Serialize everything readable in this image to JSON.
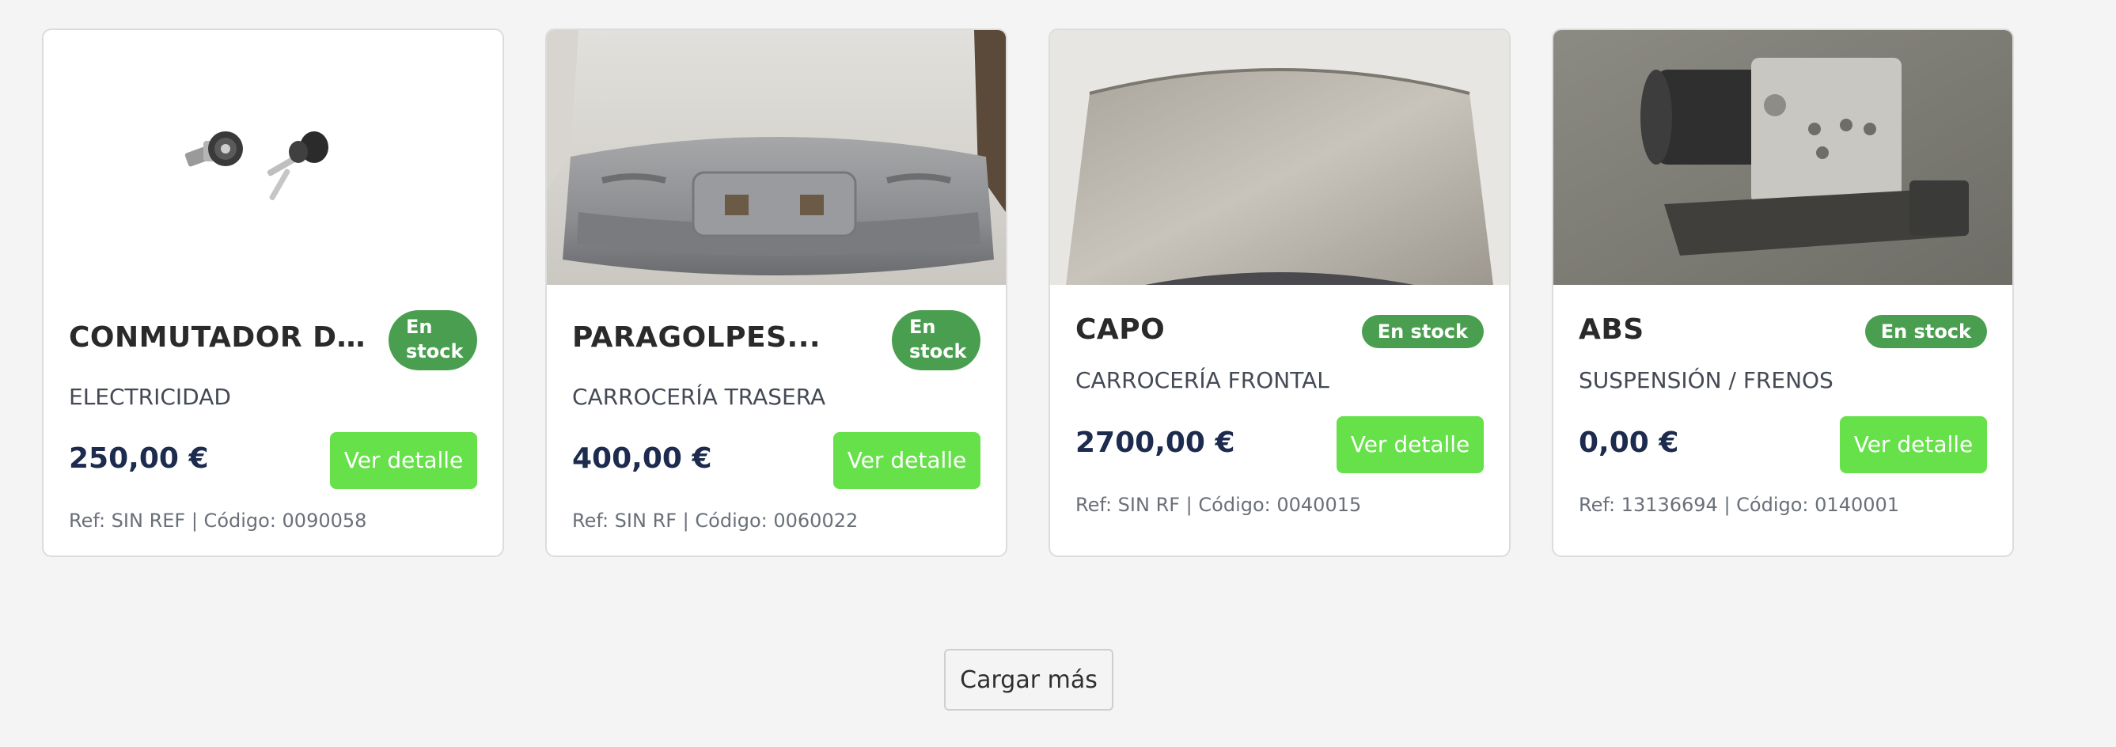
{
  "products": [
    {
      "title": "CONMUTADOR DE...",
      "badge": "En stock",
      "category": "ELECTRICIDAD",
      "price": "250,00 €",
      "button": "Ver detalle",
      "ref": "Ref: SIN REF | Código: 0090058",
      "image": "ignition-switch-with-keys"
    },
    {
      "title": "PARAGOLPES...",
      "badge": "En stock",
      "category": "CARROCERÍA TRASERA",
      "price": "400,00 €",
      "button": "Ver detalle",
      "ref": "Ref: SIN RF | Código: 0060022",
      "image": "rear-bumper"
    },
    {
      "title": "CAPO",
      "badge": "En stock",
      "category": "CARROCERÍA FRONTAL",
      "price": "2700,00 €",
      "button": "Ver detalle",
      "ref": "Ref: SIN RF | Código: 0040015",
      "image": "car-hood"
    },
    {
      "title": "ABS",
      "badge": "En stock",
      "category": "SUSPENSIÓN / FRENOS",
      "price": "0,00 €",
      "button": "Ver detalle",
      "ref": "Ref: 13136694 | Código: 0140001",
      "image": "abs-module"
    }
  ],
  "load_more": "Cargar más",
  "colors": {
    "background": "#f4f4f4",
    "badge": "#4a9e4f",
    "button": "#66e14a",
    "price": "#1c2b4e"
  }
}
